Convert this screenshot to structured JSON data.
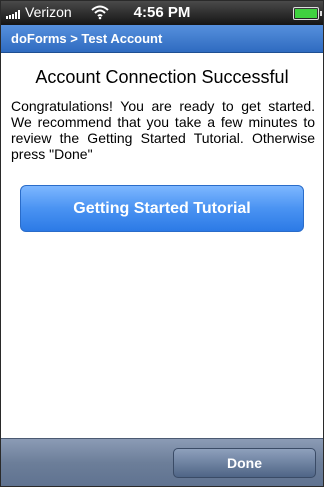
{
  "status_bar": {
    "carrier": "Verizon",
    "time": "4:56 PM",
    "icons": [
      "signal-bars-icon",
      "wifi-icon",
      "battery-icon"
    ],
    "battery_color": "#3fd23f"
  },
  "nav": {
    "breadcrumb": "doForms > Test Account"
  },
  "content": {
    "title": "Account Connection Successful",
    "message": "Congratulations! You are ready to get started. We recommend that you take a few minutes to review the Getting Started Tutorial. Otherwise press \"Done\"",
    "tutorial_button_label": "Getting Started Tutorial"
  },
  "toolbar": {
    "done_label": "Done"
  },
  "colors": {
    "nav_bar": "#3c78cc",
    "primary_button": "#4a93f2",
    "toolbar": "#6c7e99"
  }
}
